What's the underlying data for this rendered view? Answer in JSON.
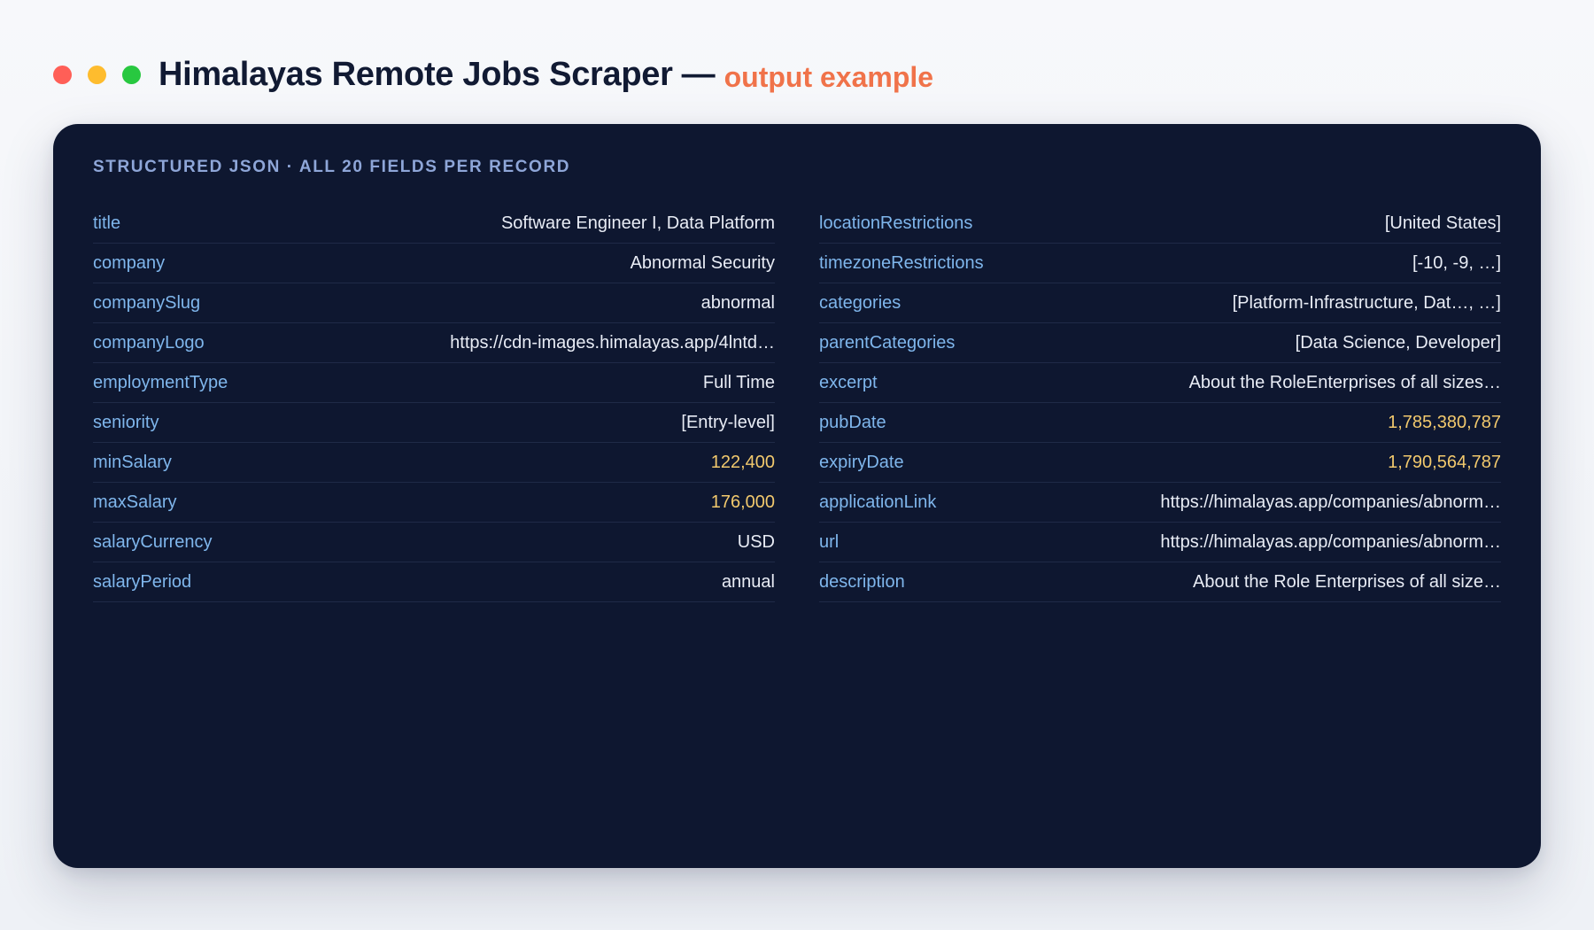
{
  "header": {
    "title": "Himalayas Remote Jobs Scraper",
    "dash": "—",
    "subtitle": "output example"
  },
  "colors": {
    "accent": "#f0734a",
    "card_bg": "#0e1730",
    "key": "#7fb6ec",
    "number": "#f2c96d",
    "dot_red": "#ff5f57",
    "dot_yellow": "#febc2e",
    "dot_green": "#28c840"
  },
  "card": {
    "label": "STRUCTURED JSON · ALL 20 FIELDS PER RECORD",
    "left": [
      {
        "key": "title",
        "value": "Software Engineer I, Data Platform",
        "numeric": false
      },
      {
        "key": "company",
        "value": "Abnormal Security",
        "numeric": false
      },
      {
        "key": "companySlug",
        "value": "abnormal",
        "numeric": false
      },
      {
        "key": "companyLogo",
        "value": "https://cdn-images.himalayas.app/4lntd…",
        "numeric": false
      },
      {
        "key": "employmentType",
        "value": "Full Time",
        "numeric": false
      },
      {
        "key": "seniority",
        "value": "[Entry-level]",
        "numeric": false
      },
      {
        "key": "minSalary",
        "value": "122,400",
        "numeric": true
      },
      {
        "key": "maxSalary",
        "value": "176,000",
        "numeric": true
      },
      {
        "key": "salaryCurrency",
        "value": "USD",
        "numeric": false
      },
      {
        "key": "salaryPeriod",
        "value": "annual",
        "numeric": false
      }
    ],
    "right": [
      {
        "key": "locationRestrictions",
        "value": "[United States]",
        "numeric": false
      },
      {
        "key": "timezoneRestrictions",
        "value": "[-10, -9, …]",
        "numeric": false
      },
      {
        "key": "categories",
        "value": "[Platform-Infrastructure, Dat…, …]",
        "numeric": false
      },
      {
        "key": "parentCategories",
        "value": "[Data Science, Developer]",
        "numeric": false
      },
      {
        "key": "excerpt",
        "value": "About the RoleEnterprises of all sizes…",
        "numeric": false
      },
      {
        "key": "pubDate",
        "value": "1,785,380,787",
        "numeric": true
      },
      {
        "key": "expiryDate",
        "value": "1,790,564,787",
        "numeric": true
      },
      {
        "key": "applicationLink",
        "value": "https://himalayas.app/companies/abnorm…",
        "numeric": false
      },
      {
        "key": "url",
        "value": "https://himalayas.app/companies/abnorm…",
        "numeric": false
      },
      {
        "key": "description",
        "value": "About the Role Enterprises of all size…",
        "numeric": false
      }
    ]
  }
}
